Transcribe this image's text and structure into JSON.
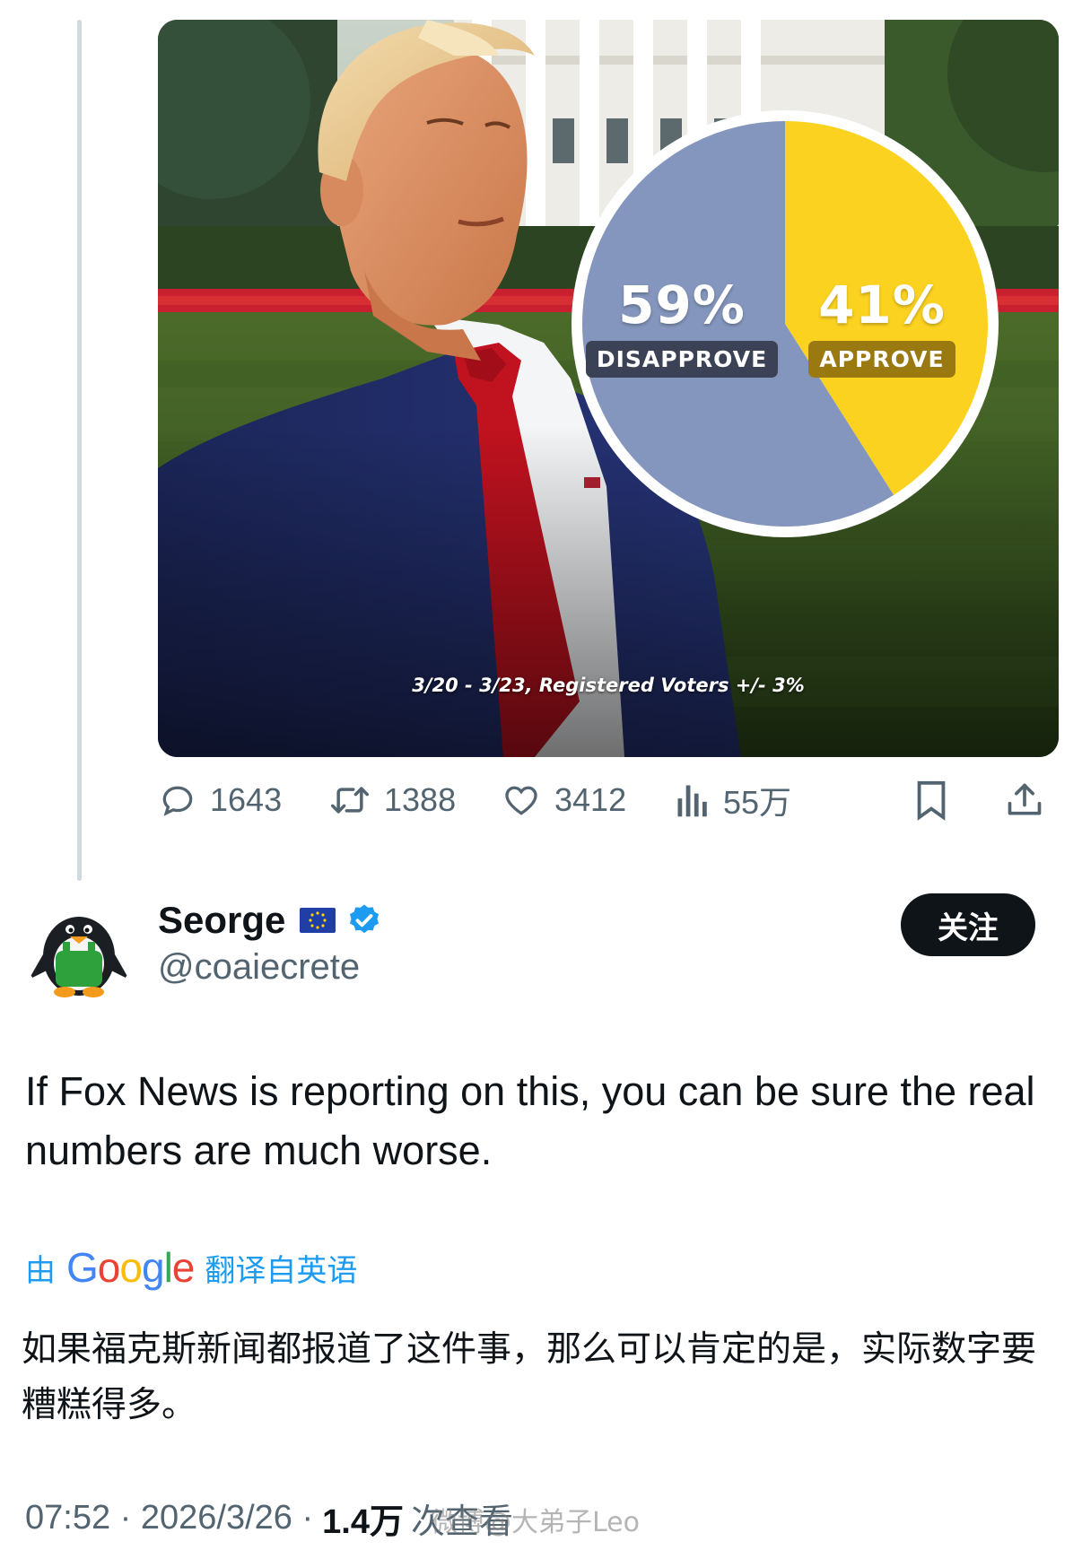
{
  "media": {
    "pie": {
      "disapprove_pct": "59%",
      "disapprove_label": "DISAPPROVE",
      "approve_pct": "41%",
      "approve_label": "APPROVE",
      "disapprove_value": 59,
      "approve_value": 41,
      "disapprove_color": "#8496bd",
      "approve_color": "#fcd220"
    },
    "footnote": "3/20 - 3/23, Registered Voters +/- 3%"
  },
  "actions": {
    "replies": "1643",
    "retweets": "1388",
    "likes": "3412",
    "views": "55万"
  },
  "user": {
    "display_name": "Seorge",
    "handle": "@coaiecrete",
    "follow_label": "关注"
  },
  "tweet": {
    "text": "If Fox News is reporting on this, you can be sure the real numbers are much worse.",
    "translation_prefix": "由",
    "translation_brand": "Google",
    "translation_suffix": "翻译自英语",
    "translated_text": "如果福克斯新闻都报道了这件事，那么可以肯定的是，实际数字要糟糕得多。"
  },
  "meta": {
    "time": "07:52 · 2026/3/26 ·",
    "views_count": "1.4万",
    "views_label": "次查看"
  },
  "watermark": "微博@大弟子Leo",
  "colors": {
    "accent": "#1d9bf0",
    "text_primary": "#0f1419",
    "text_secondary": "#536471"
  }
}
